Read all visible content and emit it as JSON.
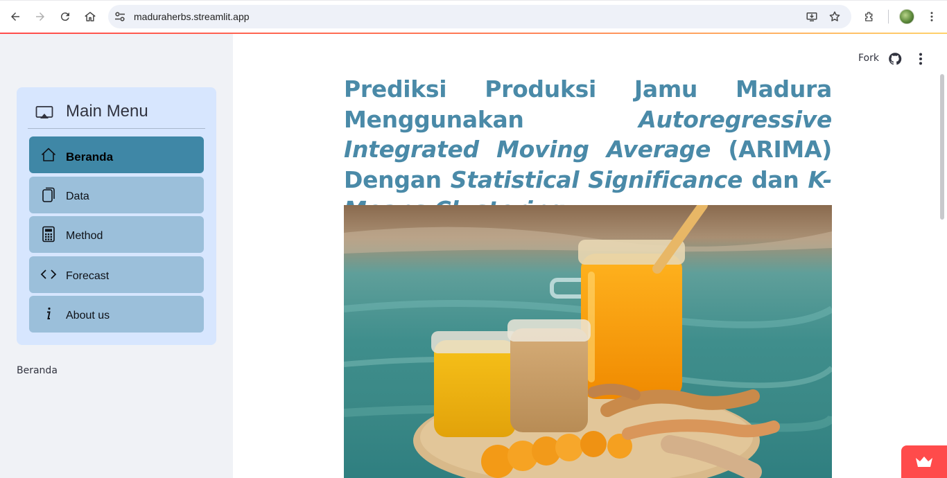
{
  "browser": {
    "url": "maduraherbs.streamlit.app",
    "icons": [
      "back-icon",
      "forward-icon",
      "reload-icon",
      "home-icon",
      "site-settings-icon",
      "install-app-icon",
      "bookmark-star-icon",
      "extensions-icon",
      "profile-avatar",
      "browser-menu-icon"
    ]
  },
  "sidebar": {
    "menu_title": "Main Menu",
    "items": [
      {
        "label": "Beranda",
        "icon": "house-icon",
        "active": true
      },
      {
        "label": "Data",
        "icon": "files-icon",
        "active": false
      },
      {
        "label": "Method",
        "icon": "calculator-icon",
        "active": false
      },
      {
        "label": "Forecast",
        "icon": "code-icon",
        "active": false
      },
      {
        "label": "About us",
        "icon": "info-icon",
        "active": false
      }
    ],
    "caption": "Beranda"
  },
  "toolbar": {
    "fork_label": "Fork",
    "icons": [
      "github-icon",
      "more-vertical-icon"
    ]
  },
  "main": {
    "title_parts": {
      "p1": "Prediksi Produksi Jamu Madura Menggunakan ",
      "p2": "Autoregressive Integrated Moving Average",
      "p3": " (ARIMA) Dengan ",
      "p4": "Statistical Significance",
      "p5": " dan ",
      "p6": "K-Means Clustering"
    }
  },
  "colors": {
    "accent": "#3f87a6",
    "menu_item": "#9bbfda",
    "menu_card": "#d7e6fe",
    "title": "#4a8aa8",
    "streamlit_red": "#ff4b4b"
  }
}
